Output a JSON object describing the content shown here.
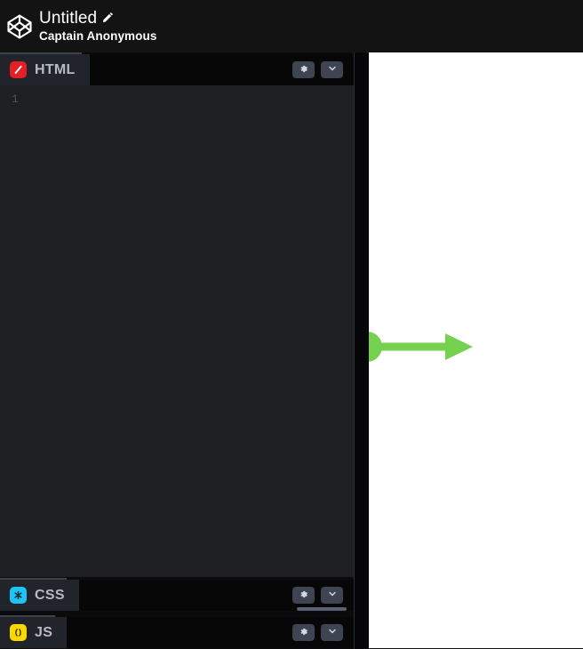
{
  "header": {
    "logo_icon": "codepen-logo-icon",
    "pen_title": "Untitled",
    "edit_icon": "pencil-icon",
    "author": "Captain Anonymous"
  },
  "editors": [
    {
      "id": "html",
      "label": "HTML",
      "icon": "html-slash-icon",
      "icon_color": "#e61e25",
      "settings_icon": "gear-icon",
      "collapse_icon": "chevron-down-icon",
      "line_number": "1",
      "code": ""
    },
    {
      "id": "css",
      "label": "CSS",
      "icon": "css-asterisk-icon",
      "icon_color": "#20c4f4",
      "settings_icon": "gear-icon",
      "collapse_icon": "chevron-down-icon",
      "line_number": "",
      "code": ""
    },
    {
      "id": "js",
      "label": "JS",
      "icon": "js-parens-icon",
      "icon_color": "#fbd800",
      "settings_icon": "gear-icon",
      "collapse_icon": "chevron-down-icon",
      "line_number": "",
      "code": ""
    }
  ],
  "preview": {
    "name": "result-preview",
    "background": "#ffffff",
    "shapes": {
      "accent_color": "#74d24f",
      "circle_name": "green-circle",
      "line_name": "green-line",
      "arrow_name": "green-arrowhead"
    }
  },
  "colors": {
    "app_background": "#0b0b0d",
    "header_background": "#131313",
    "editor_background": "#1d1f23",
    "tab_active_background": "#21242a",
    "tab_label": "#b5bac4",
    "button_background": "#3f4452",
    "divider": "#3d4148",
    "green_accent": "#74d24f"
  }
}
